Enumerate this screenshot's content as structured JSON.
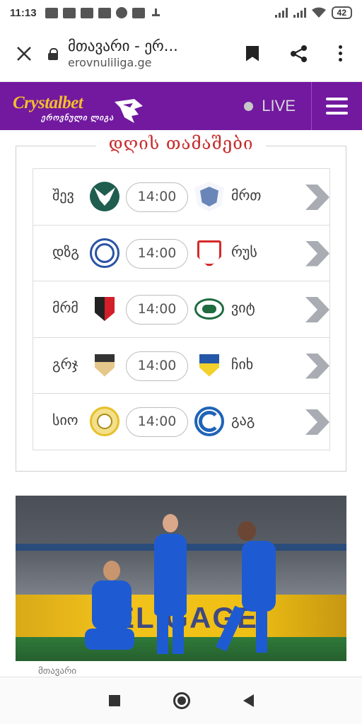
{
  "status_bar": {
    "time": "11:13",
    "battery": "42",
    "left_icons": [
      "chat-icon",
      "chat-icon",
      "facebook-icon",
      "facebook-icon",
      "skype-icon",
      "mail-icon",
      "download-icon"
    ],
    "right_icons": [
      "signal-icon",
      "signal-icon",
      "wifi-icon",
      "battery-icon"
    ]
  },
  "browser": {
    "title": "მთავარი - ერ...",
    "url": "erovnuliliga.ge",
    "close_icon": "close-icon",
    "lock_icon": "lock-icon",
    "actions": [
      "bookmark-icon",
      "share-icon",
      "more-icon"
    ]
  },
  "header": {
    "brand_name": "Crystalbet",
    "brand_sub": "ეროვნული ლიგა",
    "live_label": "LIVE",
    "accent": "#7219a0",
    "brand_color": "#f5bd2a"
  },
  "matches": {
    "title": "დღის თამაშები",
    "title_color": "#c72c2c",
    "rows": [
      {
        "home": "შევ",
        "away": "მრთ",
        "time": "14:00"
      },
      {
        "home": "დზგ",
        "away": "რუს",
        "time": "14:00"
      },
      {
        "home": "მრმ",
        "away": "ვიტ",
        "time": "14:00"
      },
      {
        "home": "გრჯ",
        "away": "ჩიხ",
        "time": "14:00"
      },
      {
        "home": "სიო",
        "away": "გაგ",
        "time": "14:00"
      }
    ]
  },
  "news": {
    "board_text": "ELIGAGE",
    "caption": "მთავარი"
  },
  "nav": [
    "recents-icon",
    "home-icon",
    "back-icon"
  ]
}
